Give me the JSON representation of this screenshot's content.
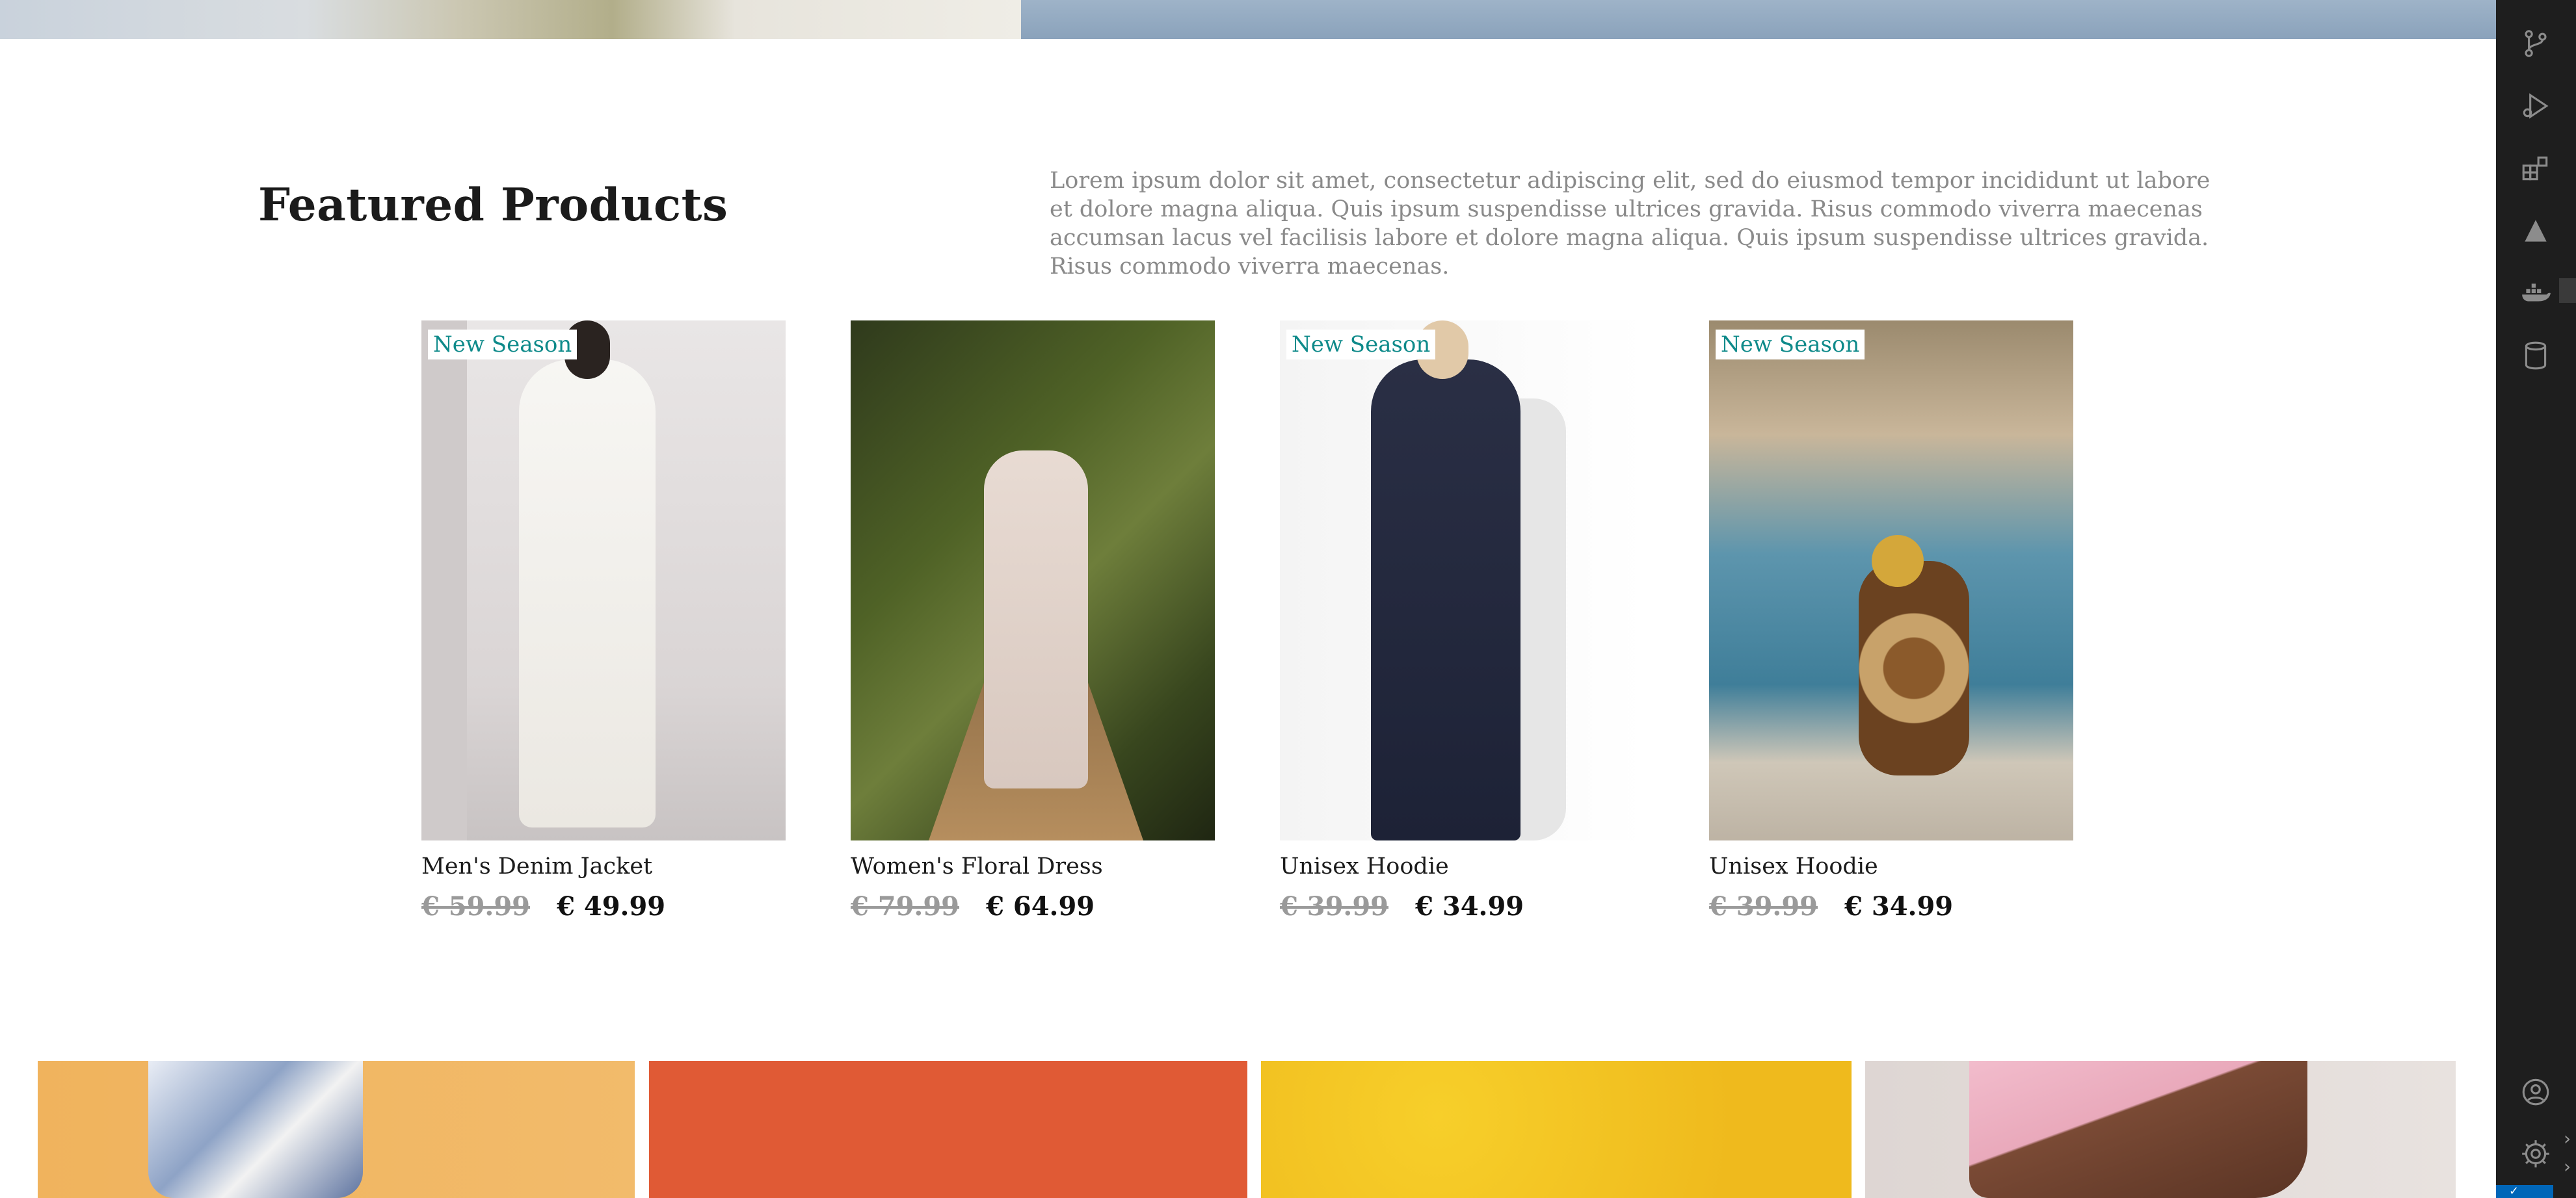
{
  "featured": {
    "title": "Featured Products",
    "description": "Lorem ipsum dolor sit amet, consectetur adipiscing elit, sed do eiusmod tempor incididunt ut labore et dolore magna aliqua. Quis ipsum suspendisse ultrices gravida. Risus commodo viverra maecenas accumsan lacus vel facilisis labore et dolore magna aliqua. Quis ipsum suspendisse ultrices gravida. Risus commodo viverra maecenas."
  },
  "products": [
    {
      "name": "Men's Denim Jacket",
      "old_price": "€ 59.99",
      "price": "€ 49.99",
      "badge": "New Season"
    },
    {
      "name": "Women's Floral Dress",
      "old_price": "€ 79.99",
      "price": "€ 64.99",
      "badge": ""
    },
    {
      "name": "Unisex Hoodie",
      "old_price": "€ 39.99",
      "price": "€ 34.99",
      "badge": "New Season"
    },
    {
      "name": "Unisex Hoodie",
      "old_price": "€ 39.99",
      "price": "€ 34.99",
      "badge": "New Season"
    }
  ],
  "activity_bar": {
    "icons": [
      "source-control-icon",
      "run-debug-icon",
      "extensions-icon",
      "triangle-icon",
      "docker-icon",
      "database-icon",
      "account-icon",
      "settings-gear-icon"
    ]
  },
  "colors": {
    "badge_text": "#0e8a8a",
    "activity_bar_bg": "#1e1e1e",
    "status_bar": "#0066b8"
  }
}
